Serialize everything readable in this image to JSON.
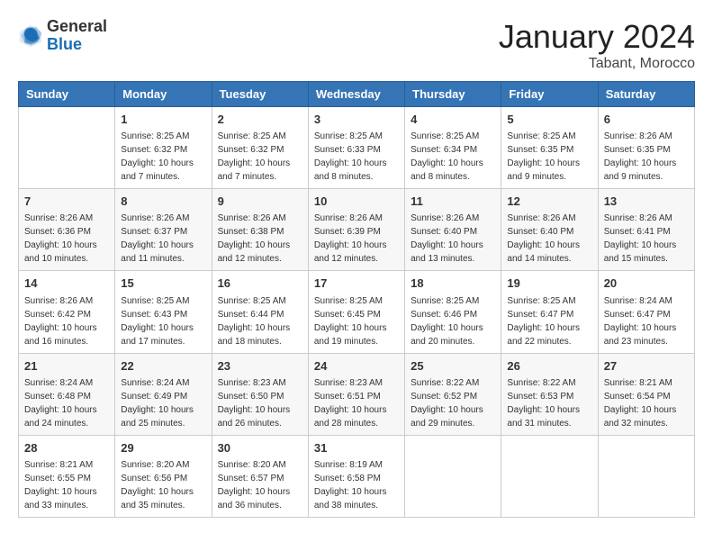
{
  "header": {
    "logo_general": "General",
    "logo_blue": "Blue",
    "month_year": "January 2024",
    "location": "Tabant, Morocco"
  },
  "days_of_week": [
    "Sunday",
    "Monday",
    "Tuesday",
    "Wednesday",
    "Thursday",
    "Friday",
    "Saturday"
  ],
  "weeks": [
    [
      {
        "day": "",
        "sunrise": "",
        "sunset": "",
        "daylight": ""
      },
      {
        "day": "1",
        "sunrise": "Sunrise: 8:25 AM",
        "sunset": "Sunset: 6:32 PM",
        "daylight": "Daylight: 10 hours and 7 minutes."
      },
      {
        "day": "2",
        "sunrise": "Sunrise: 8:25 AM",
        "sunset": "Sunset: 6:32 PM",
        "daylight": "Daylight: 10 hours and 7 minutes."
      },
      {
        "day": "3",
        "sunrise": "Sunrise: 8:25 AM",
        "sunset": "Sunset: 6:33 PM",
        "daylight": "Daylight: 10 hours and 8 minutes."
      },
      {
        "day": "4",
        "sunrise": "Sunrise: 8:25 AM",
        "sunset": "Sunset: 6:34 PM",
        "daylight": "Daylight: 10 hours and 8 minutes."
      },
      {
        "day": "5",
        "sunrise": "Sunrise: 8:25 AM",
        "sunset": "Sunset: 6:35 PM",
        "daylight": "Daylight: 10 hours and 9 minutes."
      },
      {
        "day": "6",
        "sunrise": "Sunrise: 8:26 AM",
        "sunset": "Sunset: 6:35 PM",
        "daylight": "Daylight: 10 hours and 9 minutes."
      }
    ],
    [
      {
        "day": "7",
        "sunrise": "Sunrise: 8:26 AM",
        "sunset": "Sunset: 6:36 PM",
        "daylight": "Daylight: 10 hours and 10 minutes."
      },
      {
        "day": "8",
        "sunrise": "Sunrise: 8:26 AM",
        "sunset": "Sunset: 6:37 PM",
        "daylight": "Daylight: 10 hours and 11 minutes."
      },
      {
        "day": "9",
        "sunrise": "Sunrise: 8:26 AM",
        "sunset": "Sunset: 6:38 PM",
        "daylight": "Daylight: 10 hours and 12 minutes."
      },
      {
        "day": "10",
        "sunrise": "Sunrise: 8:26 AM",
        "sunset": "Sunset: 6:39 PM",
        "daylight": "Daylight: 10 hours and 12 minutes."
      },
      {
        "day": "11",
        "sunrise": "Sunrise: 8:26 AM",
        "sunset": "Sunset: 6:40 PM",
        "daylight": "Daylight: 10 hours and 13 minutes."
      },
      {
        "day": "12",
        "sunrise": "Sunrise: 8:26 AM",
        "sunset": "Sunset: 6:40 PM",
        "daylight": "Daylight: 10 hours and 14 minutes."
      },
      {
        "day": "13",
        "sunrise": "Sunrise: 8:26 AM",
        "sunset": "Sunset: 6:41 PM",
        "daylight": "Daylight: 10 hours and 15 minutes."
      }
    ],
    [
      {
        "day": "14",
        "sunrise": "Sunrise: 8:26 AM",
        "sunset": "Sunset: 6:42 PM",
        "daylight": "Daylight: 10 hours and 16 minutes."
      },
      {
        "day": "15",
        "sunrise": "Sunrise: 8:25 AM",
        "sunset": "Sunset: 6:43 PM",
        "daylight": "Daylight: 10 hours and 17 minutes."
      },
      {
        "day": "16",
        "sunrise": "Sunrise: 8:25 AM",
        "sunset": "Sunset: 6:44 PM",
        "daylight": "Daylight: 10 hours and 18 minutes."
      },
      {
        "day": "17",
        "sunrise": "Sunrise: 8:25 AM",
        "sunset": "Sunset: 6:45 PM",
        "daylight": "Daylight: 10 hours and 19 minutes."
      },
      {
        "day": "18",
        "sunrise": "Sunrise: 8:25 AM",
        "sunset": "Sunset: 6:46 PM",
        "daylight": "Daylight: 10 hours and 20 minutes."
      },
      {
        "day": "19",
        "sunrise": "Sunrise: 8:25 AM",
        "sunset": "Sunset: 6:47 PM",
        "daylight": "Daylight: 10 hours and 22 minutes."
      },
      {
        "day": "20",
        "sunrise": "Sunrise: 8:24 AM",
        "sunset": "Sunset: 6:47 PM",
        "daylight": "Daylight: 10 hours and 23 minutes."
      }
    ],
    [
      {
        "day": "21",
        "sunrise": "Sunrise: 8:24 AM",
        "sunset": "Sunset: 6:48 PM",
        "daylight": "Daylight: 10 hours and 24 minutes."
      },
      {
        "day": "22",
        "sunrise": "Sunrise: 8:24 AM",
        "sunset": "Sunset: 6:49 PM",
        "daylight": "Daylight: 10 hours and 25 minutes."
      },
      {
        "day": "23",
        "sunrise": "Sunrise: 8:23 AM",
        "sunset": "Sunset: 6:50 PM",
        "daylight": "Daylight: 10 hours and 26 minutes."
      },
      {
        "day": "24",
        "sunrise": "Sunrise: 8:23 AM",
        "sunset": "Sunset: 6:51 PM",
        "daylight": "Daylight: 10 hours and 28 minutes."
      },
      {
        "day": "25",
        "sunrise": "Sunrise: 8:22 AM",
        "sunset": "Sunset: 6:52 PM",
        "daylight": "Daylight: 10 hours and 29 minutes."
      },
      {
        "day": "26",
        "sunrise": "Sunrise: 8:22 AM",
        "sunset": "Sunset: 6:53 PM",
        "daylight": "Daylight: 10 hours and 31 minutes."
      },
      {
        "day": "27",
        "sunrise": "Sunrise: 8:21 AM",
        "sunset": "Sunset: 6:54 PM",
        "daylight": "Daylight: 10 hours and 32 minutes."
      }
    ],
    [
      {
        "day": "28",
        "sunrise": "Sunrise: 8:21 AM",
        "sunset": "Sunset: 6:55 PM",
        "daylight": "Daylight: 10 hours and 33 minutes."
      },
      {
        "day": "29",
        "sunrise": "Sunrise: 8:20 AM",
        "sunset": "Sunset: 6:56 PM",
        "daylight": "Daylight: 10 hours and 35 minutes."
      },
      {
        "day": "30",
        "sunrise": "Sunrise: 8:20 AM",
        "sunset": "Sunset: 6:57 PM",
        "daylight": "Daylight: 10 hours and 36 minutes."
      },
      {
        "day": "31",
        "sunrise": "Sunrise: 8:19 AM",
        "sunset": "Sunset: 6:58 PM",
        "daylight": "Daylight: 10 hours and 38 minutes."
      },
      {
        "day": "",
        "sunrise": "",
        "sunset": "",
        "daylight": ""
      },
      {
        "day": "",
        "sunrise": "",
        "sunset": "",
        "daylight": ""
      },
      {
        "day": "",
        "sunrise": "",
        "sunset": "",
        "daylight": ""
      }
    ]
  ]
}
